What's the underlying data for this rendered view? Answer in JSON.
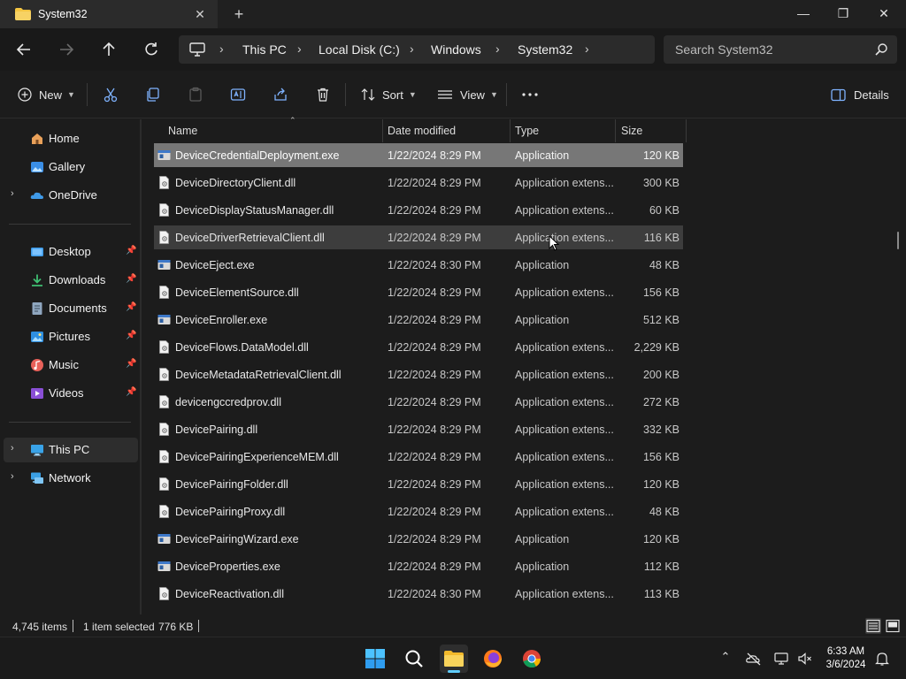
{
  "window": {
    "tab_title": "System32",
    "close_tab": "✕",
    "new_tab": "+",
    "minimize": "—",
    "maximize": "❐",
    "close": "✕"
  },
  "address": {
    "crumbs": [
      "This PC",
      "Local Disk (C:)",
      "Windows",
      "System32"
    ],
    "search_placeholder": "Search System32"
  },
  "toolbar": {
    "new_label": "New",
    "sort_label": "Sort",
    "view_label": "View",
    "details_label": "Details"
  },
  "sidebar": {
    "items": [
      {
        "label": "Home",
        "icon": "home-icon"
      },
      {
        "label": "Gallery",
        "icon": "gallery-icon"
      },
      {
        "label": "OneDrive",
        "icon": "onedrive-icon"
      },
      {
        "label": "Desktop",
        "icon": "desktop-icon"
      },
      {
        "label": "Downloads",
        "icon": "downloads-icon"
      },
      {
        "label": "Documents",
        "icon": "documents-icon"
      },
      {
        "label": "Pictures",
        "icon": "pictures-icon"
      },
      {
        "label": "Music",
        "icon": "music-icon"
      },
      {
        "label": "Videos",
        "icon": "videos-icon"
      },
      {
        "label": "This PC",
        "icon": "this-pc-icon"
      },
      {
        "label": "Network",
        "icon": "network-icon"
      }
    ]
  },
  "columns": {
    "name": "Name",
    "date": "Date modified",
    "type": "Type",
    "size": "Size"
  },
  "files": [
    {
      "name": "DeviceCredentialDeployment.exe",
      "date": "1/22/2024 8:29 PM",
      "type": "Application",
      "size": "120 KB"
    },
    {
      "name": "DeviceDirectoryClient.dll",
      "date": "1/22/2024 8:29 PM",
      "type": "Application extens...",
      "size": "300 KB"
    },
    {
      "name": "DeviceDisplayStatusManager.dll",
      "date": "1/22/2024 8:29 PM",
      "type": "Application extens...",
      "size": "60 KB"
    },
    {
      "name": "DeviceDriverRetrievalClient.dll",
      "date": "1/22/2024 8:29 PM",
      "type": "Application extens...",
      "size": "116 KB"
    },
    {
      "name": "DeviceEject.exe",
      "date": "1/22/2024 8:30 PM",
      "type": "Application",
      "size": "48 KB"
    },
    {
      "name": "DeviceElementSource.dll",
      "date": "1/22/2024 8:29 PM",
      "type": "Application extens...",
      "size": "156 KB"
    },
    {
      "name": "DeviceEnroller.exe",
      "date": "1/22/2024 8:29 PM",
      "type": "Application",
      "size": "512 KB"
    },
    {
      "name": "DeviceFlows.DataModel.dll",
      "date": "1/22/2024 8:29 PM",
      "type": "Application extens...",
      "size": "2,229 KB"
    },
    {
      "name": "DeviceMetadataRetrievalClient.dll",
      "date": "1/22/2024 8:29 PM",
      "type": "Application extens...",
      "size": "200 KB"
    },
    {
      "name": "devicengccredprov.dll",
      "date": "1/22/2024 8:29 PM",
      "type": "Application extens...",
      "size": "272 KB"
    },
    {
      "name": "DevicePairing.dll",
      "date": "1/22/2024 8:29 PM",
      "type": "Application extens...",
      "size": "332 KB"
    },
    {
      "name": "DevicePairingExperienceMEM.dll",
      "date": "1/22/2024 8:29 PM",
      "type": "Application extens...",
      "size": "156 KB"
    },
    {
      "name": "DevicePairingFolder.dll",
      "date": "1/22/2024 8:29 PM",
      "type": "Application extens...",
      "size": "120 KB"
    },
    {
      "name": "DevicePairingProxy.dll",
      "date": "1/22/2024 8:29 PM",
      "type": "Application extens...",
      "size": "48 KB"
    },
    {
      "name": "DevicePairingWizard.exe",
      "date": "1/22/2024 8:29 PM",
      "type": "Application",
      "size": "120 KB"
    },
    {
      "name": "DeviceProperties.exe",
      "date": "1/22/2024 8:29 PM",
      "type": "Application",
      "size": "112 KB"
    },
    {
      "name": "DeviceReactivation.dll",
      "date": "1/22/2024 8:30 PM",
      "type": "Application extens...",
      "size": "113 KB"
    }
  ],
  "status": {
    "item_count": "4,745 items",
    "selection": "1 item selected",
    "selection_size": "776 KB"
  },
  "clock": {
    "time": "6:33 AM",
    "date": "3/6/2024"
  },
  "colors": {
    "accent": "#60cdff",
    "selected_row": "#777777",
    "hover_row": "#3d3d3d",
    "folder": "#f4c542"
  }
}
